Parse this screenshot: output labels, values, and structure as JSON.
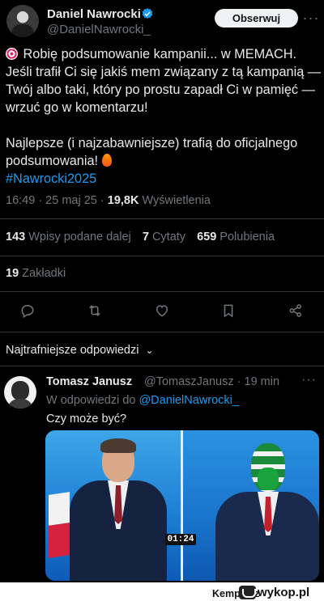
{
  "author": {
    "name": "Daniel Nawrocki",
    "handle": "@DanielNawrocki_"
  },
  "header": {
    "follow_label": "Obserwuj",
    "more_label": "···"
  },
  "tweet": {
    "line1": "Robię podsumowanie kampanii... w MEMACH.",
    "line2": "Jeśli trafił Ci się jakiś mem związany z tą kampanią — Twój albo taki, który po prostu zapadł Ci w pamięć — wrzuć go w komentarzu!",
    "line3": "Najlepsze (i najzabawniejsze) trafią do oficjalnego podsumowania!",
    "hashtag": "#Nawrocki2025"
  },
  "meta": {
    "time": "16:49 · 25 maj 25 ·",
    "views_count": "19,8K",
    "views_label": "Wyświetlenia"
  },
  "stats": {
    "reposts_count": "143",
    "reposts_label": "Wpisy podane dalej",
    "quotes_count": "7",
    "quotes_label": "Cytaty",
    "likes_count": "659",
    "likes_label": "Polubienia",
    "bookmarks_count": "19",
    "bookmarks_label": "Zakładki"
  },
  "sort": {
    "label": "Najtrafniejsze odpowiedzi"
  },
  "reply": {
    "name": "Tomasz Janusz",
    "handle_time": "@TomaszJanusz · 19 min",
    "more_label": "···",
    "reply_to_prefix": "W odpowiedzi do",
    "reply_to_handle": "@DanielNawrocki_",
    "text": "Czy może być?",
    "media_timer": "01:24"
  },
  "watermark": {
    "user": "Kempes z",
    "site": "wykop.pl"
  },
  "colors": {
    "accent": "#1d9bf0",
    "muted": "#71767b",
    "text": "#e7e9ea",
    "background": "#000000"
  },
  "icons": [
    "verified-badge-icon",
    "reply-icon",
    "repost-icon",
    "like-icon",
    "bookmark-icon",
    "share-icon",
    "chevron-down-icon",
    "target-emoji-icon",
    "fire-emoji-icon"
  ]
}
